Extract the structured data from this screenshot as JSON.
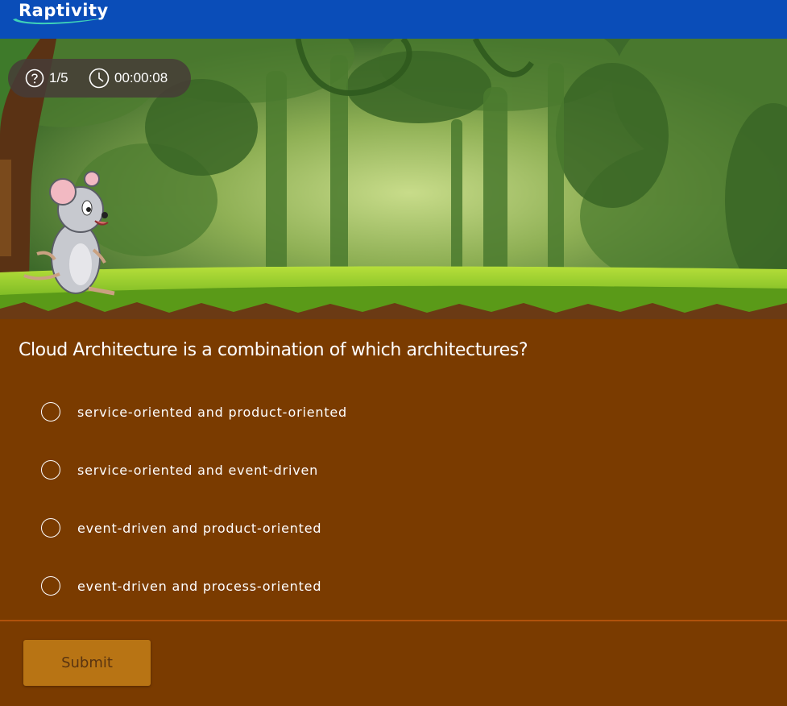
{
  "header": {
    "brand": "Raptivity"
  },
  "status": {
    "progress": "1/5",
    "timer": "00:00:08"
  },
  "question": {
    "text": "Cloud Architecture is a combination of which architectures?",
    "options": [
      {
        "label": "service-oriented and product-oriented",
        "selected": false
      },
      {
        "label": "service-oriented and event-driven",
        "selected": false
      },
      {
        "label": "event-driven and product-oriented",
        "selected": false
      },
      {
        "label": "event-driven and process-oriented",
        "selected": false
      }
    ]
  },
  "actions": {
    "submit_label": "Submit",
    "submit_enabled": false
  },
  "colors": {
    "header": "#0a4db8",
    "quiz_background": "#7a3b00",
    "submit": "#b87414",
    "divider": "#b0520c"
  },
  "icons": {
    "progress": "question-circle-icon",
    "timer": "clock-icon",
    "logo": "raptivity-logo"
  }
}
